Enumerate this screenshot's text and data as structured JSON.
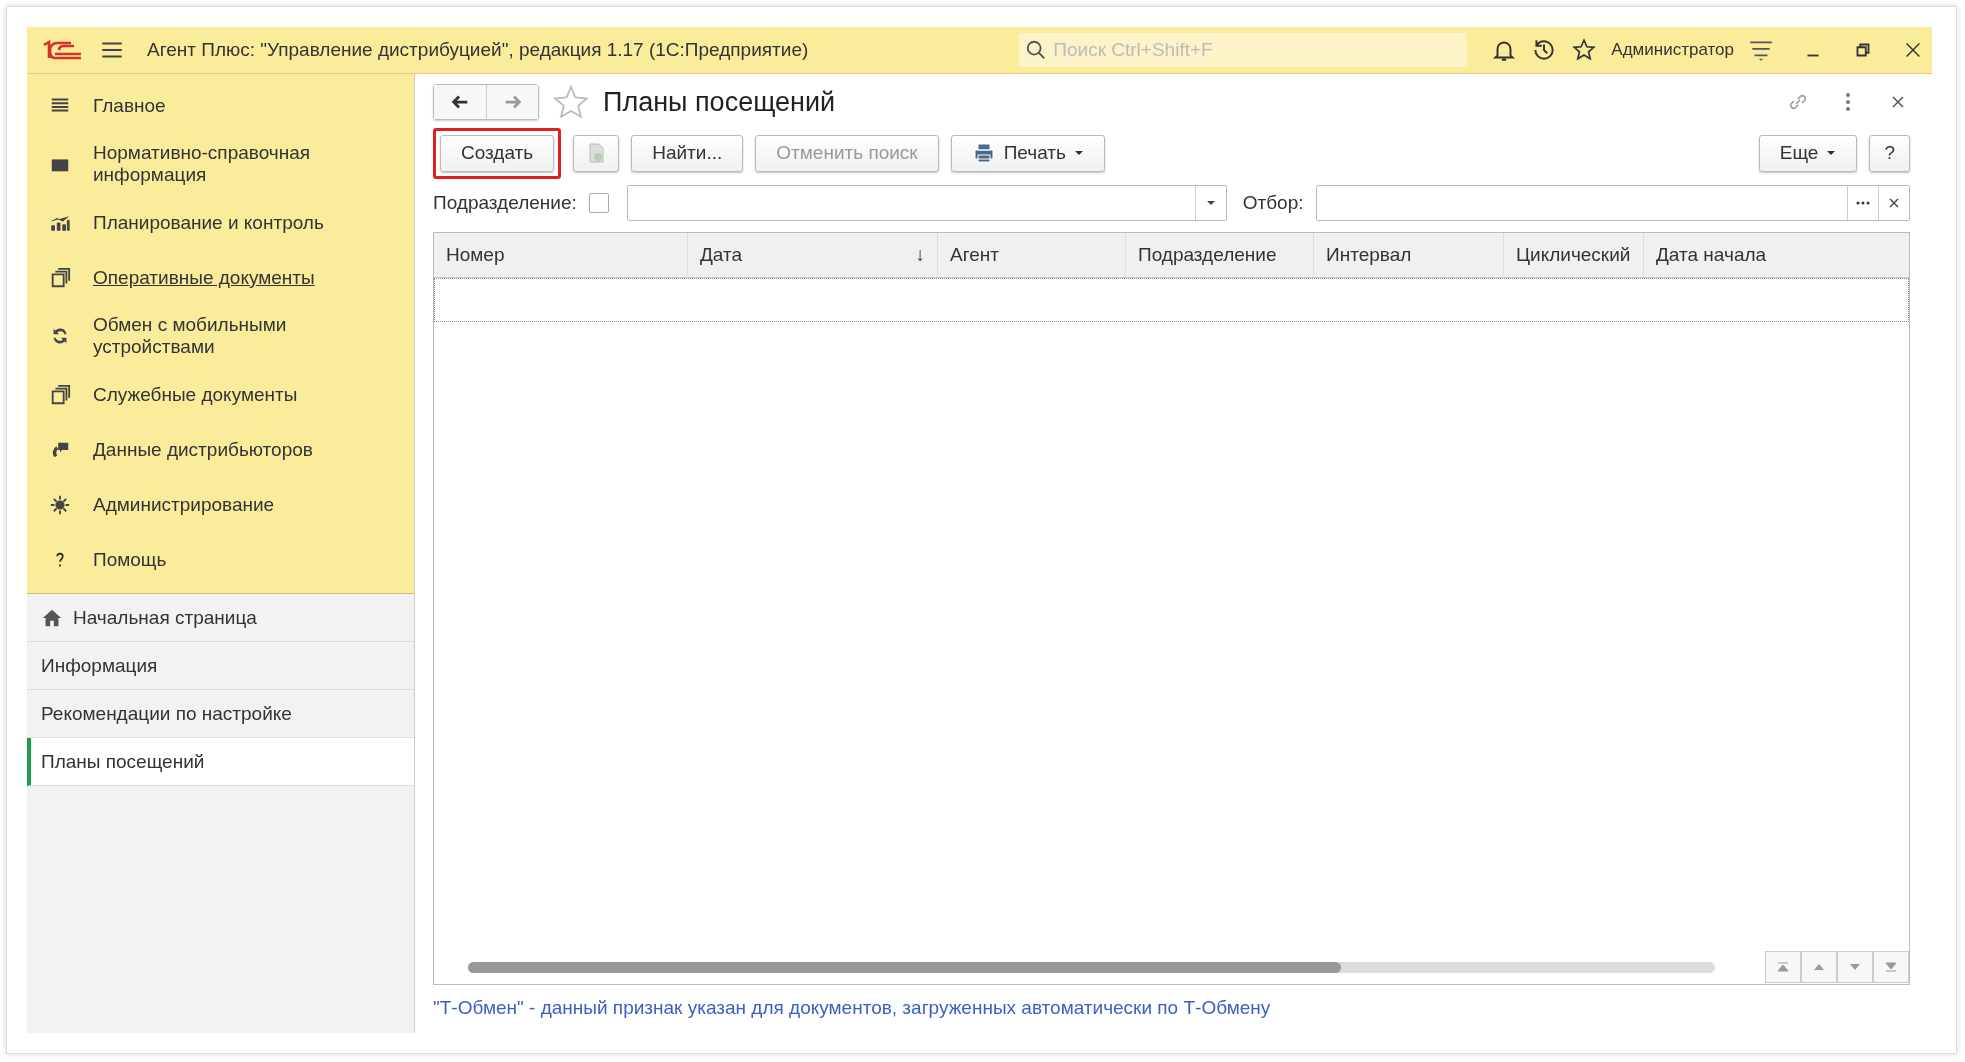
{
  "window": {
    "title": "Агент Плюс: \"Управление дистрибуцией\", редакция 1.17  (1С:Предприятие)",
    "search_placeholder": "Поиск Ctrl+Shift+F",
    "user": "Администратор"
  },
  "sidebar": {
    "sections": [
      {
        "label": "Главное",
        "selected": false
      },
      {
        "label": "Нормативно-справочная информация",
        "selected": false
      },
      {
        "label": "Планирование и контроль",
        "selected": false
      },
      {
        "label": "Оперативные документы",
        "selected": true
      },
      {
        "label": "Обмен с мобильными устройствами",
        "selected": false
      },
      {
        "label": "Служебные документы",
        "selected": false
      },
      {
        "label": "Данные дистрибьюторов",
        "selected": false
      },
      {
        "label": "Администрирование",
        "selected": false
      },
      {
        "label": "Помощь",
        "selected": false
      }
    ],
    "open_pages": [
      {
        "label": "Начальная страница",
        "kind": "home",
        "selected": false
      },
      {
        "label": "Информация",
        "kind": "page",
        "selected": false
      },
      {
        "label": "Рекомендации по настройке",
        "kind": "page",
        "selected": false
      },
      {
        "label": "Планы посещений",
        "kind": "page",
        "selected": true
      }
    ]
  },
  "form": {
    "title": "Планы посещений",
    "toolbar": [
      {
        "kind": "text",
        "label": "Создать",
        "highlighted": true,
        "disabled": false
      },
      {
        "kind": "copy",
        "disabled": true
      },
      {
        "kind": "text",
        "label": "Найти...",
        "disabled": false
      },
      {
        "kind": "text",
        "label": "Отменить поиск",
        "disabled": true
      },
      {
        "kind": "print",
        "label": "Печать",
        "disabled": false
      }
    ],
    "toolbar_right": [
      {
        "kind": "menu",
        "label": "Еще"
      },
      {
        "kind": "text",
        "label": "?"
      }
    ],
    "filters": {
      "division_label": "Подразделение:",
      "division_checked": false,
      "selection_label": "Отбор:"
    },
    "table": {
      "columns": [
        {
          "label": "Номер"
        },
        {
          "label": "Дата",
          "sort": "↓"
        },
        {
          "label": "Агент"
        },
        {
          "label": "Подразделение"
        },
        {
          "label": "Интервал"
        },
        {
          "label": "Циклический"
        },
        {
          "label": "Дата начала"
        }
      ]
    },
    "footnote": "\"Т-Обмен\" - данный признак указан для документов, загруженных автоматически по Т-Обмену"
  }
}
